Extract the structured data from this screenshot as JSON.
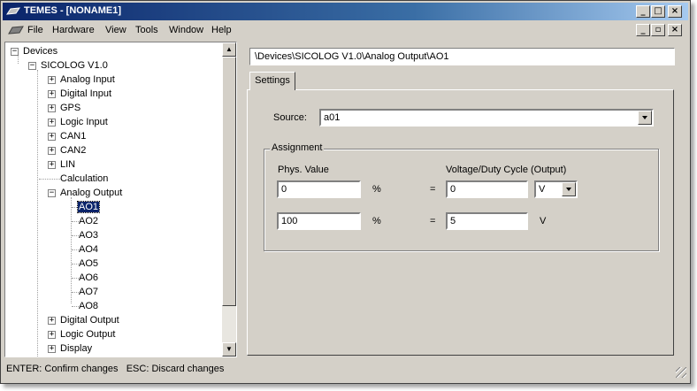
{
  "window": {
    "title": "TEMES - [NONAME1]"
  },
  "menu": [
    "File",
    "Hardware",
    "View",
    "Tools",
    "Window",
    "Help"
  ],
  "tree": {
    "root": "Devices",
    "device": "SICOLOG V1.0",
    "groups": [
      "Analog Input",
      "Digital Input",
      "GPS",
      "Logic Input",
      "CAN1",
      "CAN2",
      "LIN",
      "Calculation",
      "Analog Output"
    ],
    "outputs": [
      "AO1",
      "AO2",
      "AO3",
      "AO4",
      "AO5",
      "AO6",
      "AO7",
      "AO8"
    ],
    "groups_after": [
      "Digital Output",
      "Logic Output",
      "Display"
    ]
  },
  "path": "\\Devices\\SICOLOG V1.0\\Analog Output\\AO1",
  "tab": "Settings",
  "source": {
    "label": "Source:",
    "value": "a01"
  },
  "assignment": {
    "legend": "Assignment",
    "phys_label": "Phys. Value",
    "voltage_label": "Voltage/Duty Cycle (Output)",
    "rows": [
      {
        "phys": "0",
        "unit": "%",
        "eq": "=",
        "out": "0",
        "out_unit": "V"
      },
      {
        "phys": "100",
        "unit": "%",
        "eq": "=",
        "out": "5",
        "out_unit": "V"
      }
    ]
  },
  "status": "ENTER: Confirm changes   ESC: Discard changes"
}
